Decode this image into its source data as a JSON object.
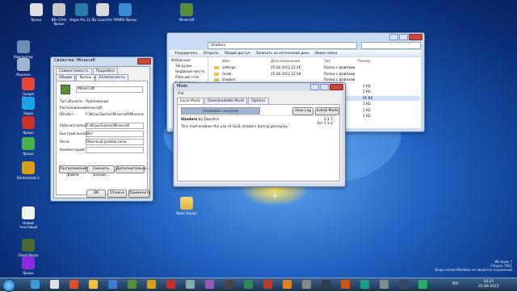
{
  "desktop_icons": [
    {
      "label": "Компьютер",
      "color": "#6c8fb8"
    },
    {
      "label": "Корзина",
      "color": "#9eb4cc"
    },
    {
      "label": "Google Chrome",
      "color": "#e8453c"
    },
    {
      "label": "Skype",
      "color": "#1aa4e6"
    },
    {
      "label": "Ярлык",
      "color": "#c9302c"
    },
    {
      "label": "Ярлык",
      "color": "#4cae4c"
    },
    {
      "label": "Borderlands 2",
      "color": "#d4a017"
    },
    {
      "label": "Новый текстовый",
      "color": "#f0f0f0"
    },
    {
      "label": "Ghost Recon Online",
      "color": "#486a2e"
    },
    {
      "label": "Ярлык",
      "color": "#8a2be2"
    }
  ],
  "top_icons": [
    {
      "label": "Ярлык",
      "color": "#e0e0e0"
    },
    {
      "label": "BB+STrm Ярлык",
      "color": "#c8c8c8"
    },
    {
      "label": "Vegas Pro 11.0",
      "color": "#2b7ba8"
    },
    {
      "label": "Ex Launcher",
      "color": "#d9d9d9"
    },
    {
      "label": "PANDA Ярлык",
      "color": "#3a8bd4"
    },
    {
      "label": "Minecraft",
      "color": "#5a8f3a"
    }
  ],
  "props_window": {
    "title": "Свойства: Minecraft",
    "tabs_row1": [
      "Совместимость",
      "Подробно",
      "Предыдущие версии"
    ],
    "tabs_row2": [
      "Общие",
      "Ярлык",
      "Безопасность"
    ],
    "name": "Minecraft",
    "rows": [
      {
        "label": "Тип объекта:",
        "value": "Приложение"
      },
      {
        "label": "Расположение:",
        "value": "minecraft"
      },
      {
        "label": "Объект:",
        "value": "F:\\Игры\\Games\\Minecraft\\Minecraft.exe"
      }
    ],
    "rows2": [
      {
        "label": "Рабочая папка:",
        "value": "F:\\Игры\\Games\\Minecraft"
      },
      {
        "label": "Быстрый вызов:",
        "value": "Нет"
      },
      {
        "label": "Окно:",
        "value": "Обычный размер окна"
      },
      {
        "label": "Комментарий:",
        "value": ""
      }
    ],
    "btn_location": "Расположение файла",
    "btn_icon": "Сменить значок...",
    "btn_advanced": "Дополнительно...",
    "ok": "ОК",
    "cancel": "Отмена",
    "apply": "Применить"
  },
  "explorer": {
    "address": "Shaders",
    "toolbar": [
      "Упорядочить",
      "Открыть",
      "Общий доступ",
      "Записать на оптический диск",
      "Новая папка"
    ],
    "nav": [
      "Избранное",
      "Загрузки",
      "Недавние места",
      "Рабочий стол",
      "Библиотеки"
    ],
    "col_name": "Имя",
    "col_date": "Дата изменения",
    "col_type": "Тип",
    "col_size": "Размер",
    "files": [
      {
        "name": "settings",
        "date": "25.08.2012 22:16",
        "type": "Папка с файлами",
        "size": ""
      },
      {
        "name": "mods",
        "date": "25.08.2012 22:18",
        "type": "Папка с файлами",
        "size": ""
      },
      {
        "name": "shaders",
        "date": "",
        "type": "Папка с файлами",
        "size": ""
      },
      {
        "name": "",
        "date": "",
        "type": "",
        "size": "1 КБ"
      },
      {
        "name": "",
        "date": "",
        "type": "",
        "size": "1 КБ"
      },
      {
        "name": "",
        "date": "",
        "type": "",
        "size": "95 КБ"
      },
      {
        "name": "",
        "date": "",
        "type": "",
        "size": "1 КБ"
      },
      {
        "name": "",
        "date": "",
        "type": "",
        "size": "1 КБ"
      },
      {
        "name": "",
        "date": "",
        "type": "",
        "size": "1 КБ"
      }
    ]
  },
  "mod_window": {
    "title": "Mods",
    "menu": "File",
    "tabs": [
      "Local Mods",
      "Downloadable Mods",
      "Options"
    ],
    "progress_label": "Installation complete",
    "progress": 1.0,
    "view_log": "View Log",
    "install": "Install Mods",
    "mod_name": "Shaders",
    "mod_author": "by Daxnitro",
    "mod_version": "2.1.7",
    "mod_version2": "For 1.3.2",
    "mod_desc": "This mod enables the use of GLSL shaders during gameplay."
  },
  "desktop_folder": "Mods Shader",
  "taskbar": {
    "lang": "RU",
    "time": "16:21",
    "date": "25.08.2012",
    "watermark1": "Windows 7",
    "watermark2": "Сборка 7601",
    "watermark3": "Ваша копия Windows не является подлинной",
    "items": [
      "#3c9ad8",
      "#e0e0e0",
      "#e24b2a",
      "#f2c23a",
      "#3b7bd1",
      "#5a8f3a",
      "#d4a017",
      "#c62d2d",
      "#8aa",
      "#9b59b6",
      "#444",
      "#2e8b57",
      "#c0392b",
      "#e67e22",
      "#888",
      "#2c3e50",
      "#d35400",
      "#16a085",
      "#7f8c8d",
      "#34495e",
      "#27ae60"
    ]
  }
}
